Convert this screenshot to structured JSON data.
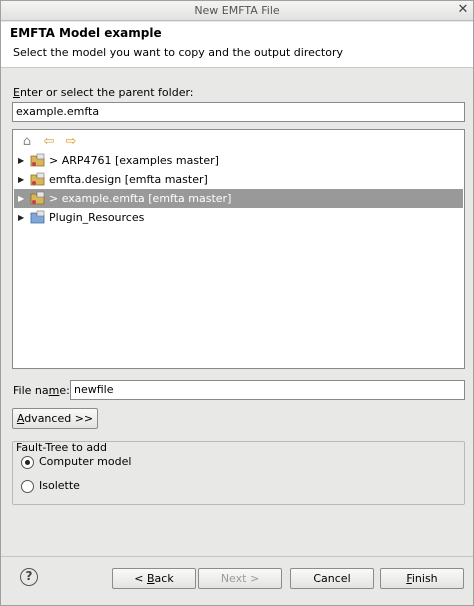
{
  "window": {
    "title": "New EMFTA File"
  },
  "header": {
    "title": "EMFTA Model example",
    "description": "Select the model you want to copy and the output directory"
  },
  "parent_folder": {
    "label_first": "E",
    "label_rest": "nter or select the parent folder:",
    "value": "example.emfta"
  },
  "tree": {
    "toolbar": [
      "home-icon",
      "back-arrow-icon",
      "forward-arrow-icon"
    ],
    "items": [
      {
        "label": "> ARP4761  [examples master]",
        "selected": false
      },
      {
        "label": "emfta.design  [emfta master]",
        "selected": false
      },
      {
        "label": "> example.emfta  [emfta master]",
        "selected": true
      },
      {
        "label": "Plugin_Resources",
        "selected": false
      }
    ]
  },
  "file_name": {
    "label_pre": "File na",
    "label_u": "m",
    "label_post": "e:",
    "value": "newfile"
  },
  "advanced": {
    "label_u": "A",
    "label_rest": "dvanced >>"
  },
  "fault_tree": {
    "title": "Fault-Tree to add",
    "options": [
      {
        "label": "Computer model",
        "checked": true
      },
      {
        "label": "Isolette",
        "checked": false
      }
    ]
  },
  "buttons": {
    "back_pre": "< ",
    "back_u": "B",
    "back_post": "ack",
    "next": "Next >",
    "cancel": "Cancel",
    "finish_u": "F",
    "finish_rest": "inish"
  },
  "help": {
    "glyph": "?"
  },
  "colors": {
    "selection": "#999999",
    "background": "#e8e8e7"
  }
}
